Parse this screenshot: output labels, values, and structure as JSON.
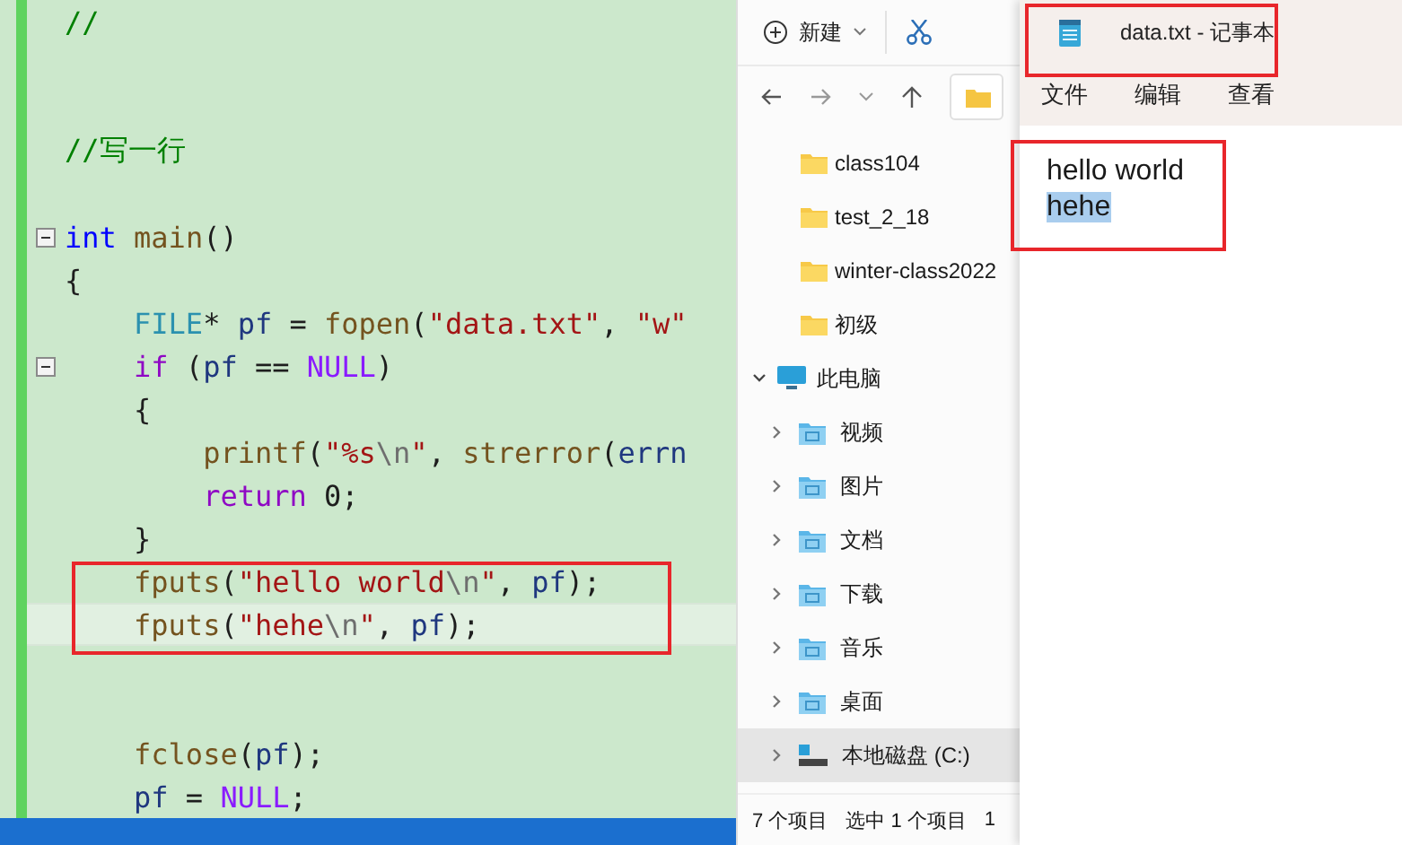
{
  "editor": {
    "lines": [
      {
        "foldable": false,
        "current": false,
        "tokens": [
          {
            "kind": "comment",
            "text": "//"
          }
        ]
      },
      {
        "foldable": false,
        "current": false
      },
      {
        "foldable": false,
        "current": false
      },
      {
        "foldable": false,
        "current": false,
        "tokens": [
          {
            "kind": "comment",
            "text": "//写一行"
          }
        ]
      },
      {
        "foldable": false,
        "current": false
      },
      {
        "foldable": true,
        "current": false,
        "tokens": [
          {
            "kind": "kw",
            "text": "int"
          },
          {
            "kind": "fn",
            "text": " main"
          },
          {
            "kind": "plain",
            "text": "()"
          }
        ]
      },
      {
        "foldable": false,
        "current": false,
        "tokens": [
          {
            "kind": "plain",
            "text": "{"
          }
        ]
      },
      {
        "foldable": false,
        "current": false,
        "tokens": [
          {
            "kind": "type",
            "text": "    FILE"
          },
          {
            "kind": "plain",
            "text": "* "
          },
          {
            "kind": "var",
            "text": "pf"
          },
          {
            "kind": "plain",
            "text": " = "
          },
          {
            "kind": "fn",
            "text": "fopen"
          },
          {
            "kind": "plain",
            "text": "("
          },
          {
            "kind": "str",
            "text": "\"data.txt\""
          },
          {
            "kind": "plain",
            "text": ", "
          },
          {
            "kind": "str",
            "text": "\"w\""
          }
        ]
      },
      {
        "foldable": true,
        "current": false,
        "tokens": [
          {
            "kind": "ctrl",
            "text": "    if"
          },
          {
            "kind": "plain",
            "text": " ("
          },
          {
            "kind": "var",
            "text": "pf"
          },
          {
            "kind": "plain",
            "text": " == "
          },
          {
            "kind": "macro",
            "text": "NULL"
          },
          {
            "kind": "plain",
            "text": ")"
          }
        ]
      },
      {
        "foldable": false,
        "current": false,
        "tokens": [
          {
            "kind": "plain",
            "text": "    {"
          }
        ]
      },
      {
        "foldable": false,
        "current": false,
        "tokens": [
          {
            "kind": "fn",
            "text": "        printf"
          },
          {
            "kind": "plain",
            "text": "("
          },
          {
            "kind": "str",
            "text": "\"%s"
          },
          {
            "kind": "esc",
            "text": "\\n"
          },
          {
            "kind": "str",
            "text": "\""
          },
          {
            "kind": "plain",
            "text": ", "
          },
          {
            "kind": "fn",
            "text": "strerror"
          },
          {
            "kind": "plain",
            "text": "("
          },
          {
            "kind": "var",
            "text": "errn"
          }
        ]
      },
      {
        "foldable": false,
        "current": false,
        "tokens": [
          {
            "kind": "ctrl",
            "text": "        return"
          },
          {
            "kind": "plain",
            "text": " 0;"
          }
        ]
      },
      {
        "foldable": false,
        "current": false,
        "tokens": [
          {
            "kind": "plain",
            "text": "    }"
          }
        ]
      },
      {
        "foldable": false,
        "current": false,
        "tokens": [
          {
            "kind": "fn",
            "text": "    fputs"
          },
          {
            "kind": "plain",
            "text": "("
          },
          {
            "kind": "str",
            "text": "\"hello world"
          },
          {
            "kind": "esc",
            "text": "\\n"
          },
          {
            "kind": "str",
            "text": "\""
          },
          {
            "kind": "plain",
            "text": ", "
          },
          {
            "kind": "var",
            "text": "pf"
          },
          {
            "kind": "plain",
            "text": ");"
          }
        ]
      },
      {
        "foldable": false,
        "current": true,
        "tokens": [
          {
            "kind": "fn",
            "text": "    fputs"
          },
          {
            "kind": "plain",
            "text": "("
          },
          {
            "kind": "str",
            "text": "\"hehe"
          },
          {
            "kind": "esc",
            "text": "\\n"
          },
          {
            "kind": "str",
            "text": "\""
          },
          {
            "kind": "plain",
            "text": ", "
          },
          {
            "kind": "var",
            "text": "pf"
          },
          {
            "kind": "plain",
            "text": ");"
          }
        ]
      },
      {
        "foldable": false,
        "current": false
      },
      {
        "foldable": false,
        "current": false
      },
      {
        "foldable": false,
        "current": false,
        "tokens": [
          {
            "kind": "fn",
            "text": "    fclose"
          },
          {
            "kind": "plain",
            "text": "("
          },
          {
            "kind": "var",
            "text": "pf"
          },
          {
            "kind": "plain",
            "text": ");"
          }
        ]
      },
      {
        "foldable": false,
        "current": false,
        "tokens": [
          {
            "kind": "var",
            "text": "    pf"
          },
          {
            "kind": "plain",
            "text": " = "
          },
          {
            "kind": "macro",
            "text": "NULL"
          },
          {
            "kind": "plain",
            "text": ";"
          }
        ]
      }
    ]
  },
  "explorer": {
    "new_button": "新建",
    "quick_folders": [
      {
        "label": "class104",
        "selected": false
      },
      {
        "label": "test_2_18",
        "selected": false
      },
      {
        "label": "winter-class2022",
        "selected": false
      },
      {
        "label": "初级",
        "selected": false
      }
    ],
    "this_pc": {
      "label": "此电脑",
      "expanded": true,
      "selected": false,
      "children": [
        {
          "label": "视频",
          "kind": "library",
          "expanded": false,
          "selected": false
        },
        {
          "label": "图片",
          "kind": "library",
          "expanded": false,
          "selected": false
        },
        {
          "label": "文档",
          "kind": "library",
          "expanded": false,
          "selected": false
        },
        {
          "label": "下载",
          "kind": "library",
          "expanded": false,
          "selected": false
        },
        {
          "label": "音乐",
          "kind": "library",
          "expanded": false,
          "selected": false
        },
        {
          "label": "桌面",
          "kind": "library",
          "expanded": false,
          "selected": false
        },
        {
          "label": "本地磁盘 (C:)",
          "kind": "drive",
          "expanded": false,
          "selected": true
        }
      ]
    },
    "status_bar": [
      "7 个项目",
      "选中 1 个项目",
      "1"
    ]
  },
  "notepad": {
    "title": "data.txt - 记事本",
    "menu": [
      "文件",
      "编辑",
      "查看"
    ],
    "lines": [
      {
        "text": "hello world",
        "selected": false
      },
      {
        "text": "hehe",
        "selected": true
      }
    ]
  }
}
